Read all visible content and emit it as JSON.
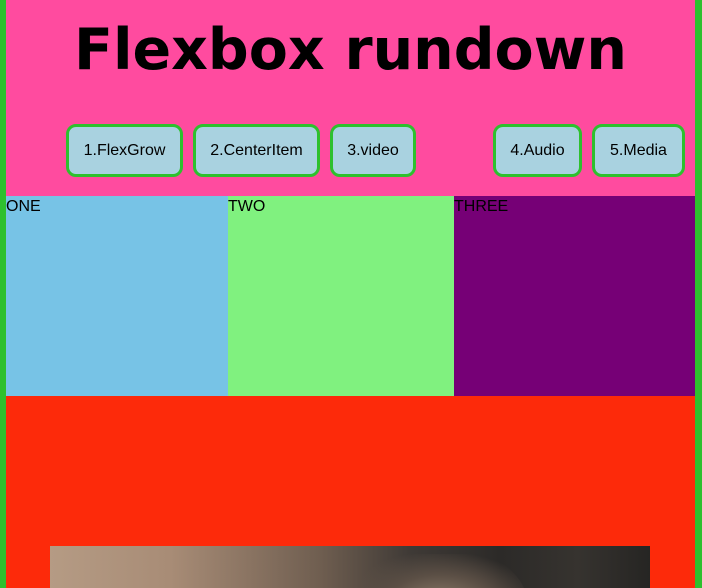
{
  "header": {
    "title": "Flexbox rundown"
  },
  "nav": {
    "buttons": [
      {
        "label": "1.FlexGrow"
      },
      {
        "label": "2.CenterItem"
      },
      {
        "label": "3.video"
      },
      {
        "label": "4.Audio"
      },
      {
        "label": "5.Media"
      }
    ]
  },
  "boxes": [
    {
      "label": "ONE",
      "color": "#77c3e6"
    },
    {
      "label": "TWO",
      "color": "#80f17f"
    },
    {
      "label": "THREE",
      "color": "#760076"
    }
  ],
  "colors": {
    "page_border": "#2ec02e",
    "header_background": "#ff4b9f",
    "button_background": "#a9d2e0",
    "button_border": "#2ec02e",
    "media_section_background": "#fd2a0a"
  },
  "media": {
    "kind": "image",
    "description_icon": "photo-image"
  }
}
